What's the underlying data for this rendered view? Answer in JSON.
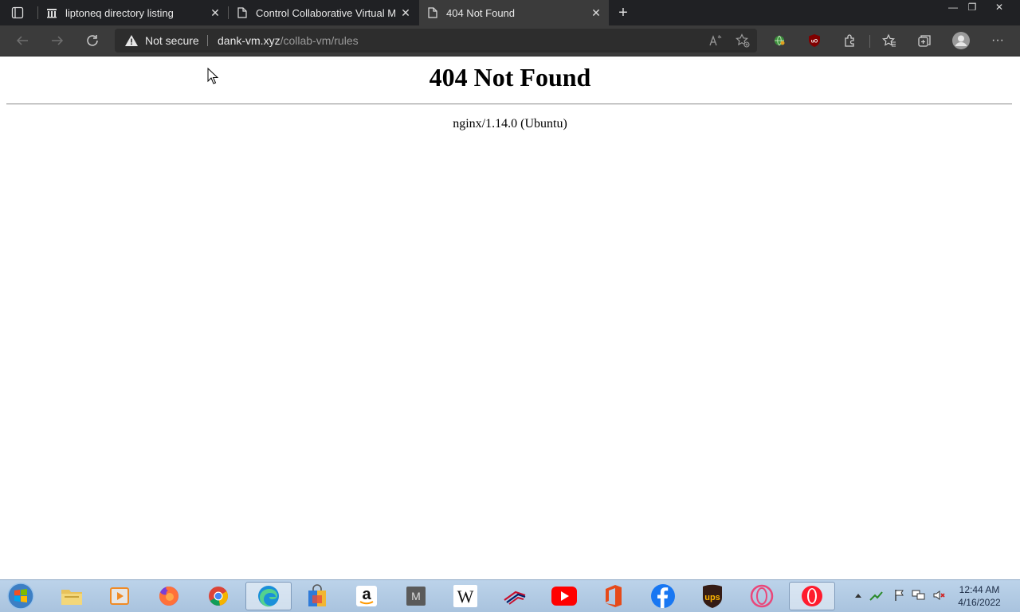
{
  "browser": {
    "tabs": [
      {
        "title": "liptoneq directory listing",
        "icon": "building-icon",
        "active": false
      },
      {
        "title": "Control Collaborative Virtual Ma",
        "icon": "page-icon",
        "active": false
      },
      {
        "title": "404 Not Found",
        "icon": "page-icon",
        "active": true
      }
    ],
    "close_glyph": "✕",
    "new_tab_glyph": "+",
    "window": {
      "minimize": "—",
      "restore": "❐",
      "close": "✕"
    },
    "address": {
      "security_label": "Not secure",
      "host": "dank-vm.xyz",
      "path": "/collab-vm/rules"
    },
    "menu_glyph": "···"
  },
  "page": {
    "heading": "404 Not Found",
    "server_line": "nginx/1.14.0 (Ubuntu)"
  },
  "taskbar": {
    "pinned": [
      "file-explorer",
      "media-player",
      "firefox",
      "chrome",
      "edge",
      "store",
      "amazon",
      "m-app",
      "wikipedia",
      "bank",
      "youtube",
      "office",
      "facebook",
      "ups",
      "opera-gx",
      "opera"
    ],
    "amazon_letter": "a",
    "m_letter": "M",
    "wiki_letter": "W",
    "ups_text": "ups",
    "clock": {
      "time": "12:44 AM",
      "date": "4/16/2022"
    }
  }
}
